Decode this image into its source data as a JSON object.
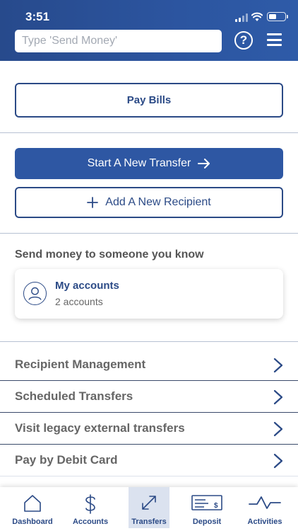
{
  "status_bar": {
    "time": "3:51"
  },
  "search": {
    "placeholder": "Type 'Send Money'"
  },
  "header": {
    "help_icon": "question-circle-icon",
    "menu_icon": "hamburger-menu-icon"
  },
  "actions": {
    "pay_bills": "Pay Bills",
    "start_transfer": "Start A New Transfer",
    "add_recipient": "Add A New Recipient"
  },
  "send_money": {
    "title": "Send money to someone you know",
    "card": {
      "title": "My accounts",
      "subtitle": "2 accounts",
      "icon": "person-icon"
    }
  },
  "menu_items": [
    {
      "label": "Recipient Management"
    },
    {
      "label": "Scheduled Transfers"
    },
    {
      "label": "Visit legacy external transfers"
    },
    {
      "label": "Pay by Debit Card"
    }
  ],
  "tabs": [
    {
      "label": "Dashboard",
      "icon": "home-icon"
    },
    {
      "label": "Accounts",
      "icon": "dollar-icon"
    },
    {
      "label": "Transfers",
      "icon": "transfer-arrows-icon",
      "active": true
    },
    {
      "label": "Deposit",
      "icon": "check-deposit-icon"
    },
    {
      "label": "Activities",
      "icon": "activity-pulse-icon"
    }
  ],
  "colors": {
    "brand": "#2e57a3",
    "header": "#274a8c",
    "active_tab": "#dbe2ef"
  }
}
